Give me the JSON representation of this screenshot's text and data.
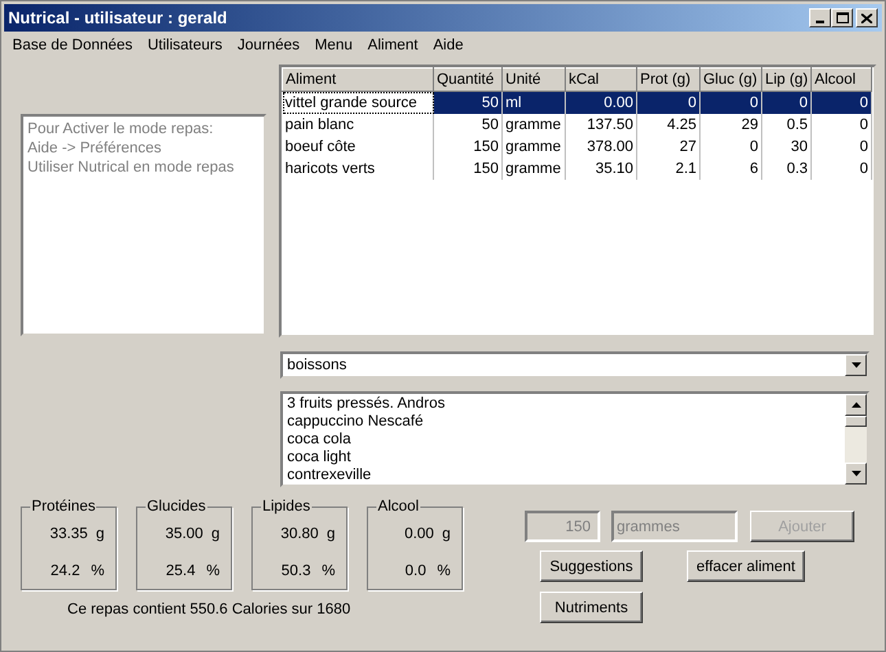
{
  "window": {
    "title": "Nutrical - utilisateur : gerald"
  },
  "menu": [
    "Base de Données",
    "Utilisateurs",
    "Journées",
    "Menu",
    "Aliment",
    "Aide"
  ],
  "info_box": {
    "lines": [
      "Pour Activer le mode repas:",
      "Aide -> Préférences",
      "Utiliser Nutrical en mode repas"
    ]
  },
  "table": {
    "columns": [
      "Aliment",
      "Quantité",
      "Unité",
      "kCal",
      "Prot (g)",
      "Gluc (g)",
      "Lip (g)",
      "Alcool"
    ],
    "rows": [
      {
        "cells": [
          "vittel grande source",
          "50",
          "ml",
          "0.00",
          "0",
          "0",
          "0",
          "0"
        ],
        "selected": true
      },
      {
        "cells": [
          "pain blanc",
          "50",
          "gramme",
          "137.50",
          "4.25",
          "29",
          "0.5",
          "0"
        ],
        "selected": false
      },
      {
        "cells": [
          "boeuf côte",
          "150",
          "gramme",
          "378.00",
          "27",
          "0",
          "30",
          "0"
        ],
        "selected": false
      },
      {
        "cells": [
          "haricots verts",
          "150",
          "gramme",
          "35.10",
          "2.1",
          "6",
          "0.3",
          "0"
        ],
        "selected": false
      }
    ]
  },
  "category": {
    "value": "boissons"
  },
  "food_list": [
    "3 fruits pressés. Andros",
    "cappuccino Nescafé",
    "coca cola",
    "coca light",
    "contrexeville"
  ],
  "totals": [
    {
      "label": "Protéines",
      "grams": "33.35",
      "grams_unit": "g",
      "percent": "24.2",
      "percent_unit": "%"
    },
    {
      "label": "Glucides",
      "grams": "35.00",
      "grams_unit": "g",
      "percent": "25.4",
      "percent_unit": "%"
    },
    {
      "label": "Lipides",
      "grams": "30.80",
      "grams_unit": "g",
      "percent": "50.3",
      "percent_unit": "%"
    },
    {
      "label": "Alcool",
      "grams": "0.00",
      "grams_unit": "g",
      "percent": "0.0",
      "percent_unit": "%"
    }
  ],
  "summary": "Ce repas contient 550.6 Calories sur 1680",
  "quantity": {
    "value": "150",
    "disabled": true
  },
  "unit": {
    "value": "grammes",
    "disabled": true
  },
  "buttons": [
    {
      "label": "Ajouter",
      "disabled": true
    },
    {
      "label": "Suggestions",
      "disabled": false
    },
    {
      "label": "effacer aliment",
      "disabled": false
    },
    {
      "label": "Nutriments",
      "disabled": false
    }
  ]
}
